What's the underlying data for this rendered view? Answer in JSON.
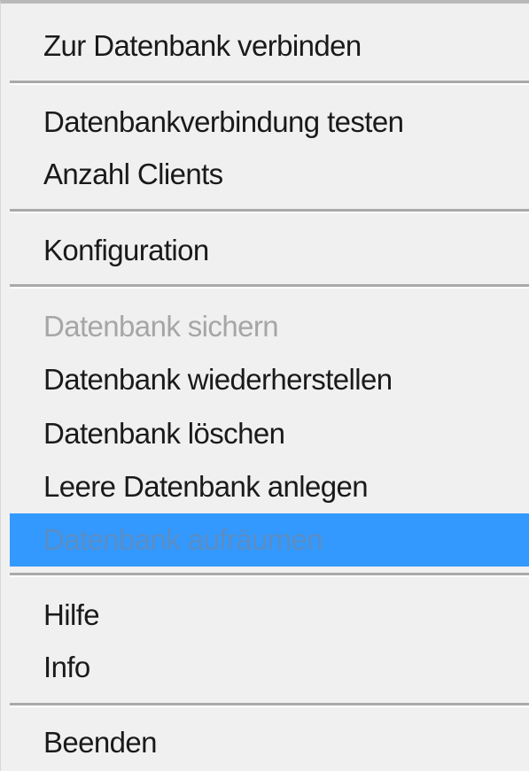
{
  "menu": {
    "items": [
      {
        "label": "Zur Datenbank verbinden",
        "enabled": true
      },
      {
        "label": "Datenbankverbindung testen",
        "enabled": true
      },
      {
        "label": "Anzahl Clients",
        "enabled": true
      },
      {
        "label": "Konfiguration",
        "enabled": true
      },
      {
        "label": "Datenbank sichern",
        "enabled": false
      },
      {
        "label": "Datenbank wiederherstellen",
        "enabled": true
      },
      {
        "label": "Datenbank löschen",
        "enabled": true
      },
      {
        "label": "Leere Datenbank anlegen",
        "enabled": true
      },
      {
        "label": "Datenbank aufräumen",
        "enabled": false,
        "highlighted": true
      },
      {
        "label": "Hilfe",
        "enabled": true
      },
      {
        "label": "Info",
        "enabled": true
      },
      {
        "label": "Beenden",
        "enabled": true
      }
    ]
  },
  "colors": {
    "menu_background": "#f0f0f0",
    "highlight": "#3399ff",
    "disabled_text": "#a6a6a6",
    "separator": "#a9a9a9"
  }
}
